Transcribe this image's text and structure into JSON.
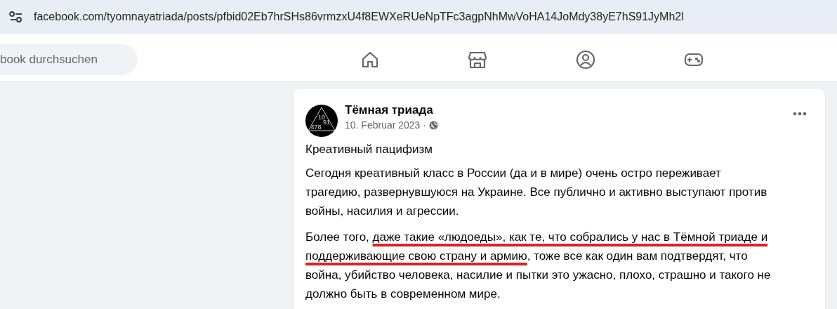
{
  "address_bar": {
    "url": "facebook.com/tyomnayatriada/posts/pfbid02Eb7hrSHs86vrmzxU4f8EWXeRUeNpTFc3agpNhMwVoHA14JoMdy38yE7hS91JyMh2l"
  },
  "search": {
    "placeholder": "book durchsuchen"
  },
  "nav": [
    {
      "kind": "home"
    },
    {
      "kind": "store"
    },
    {
      "kind": "groups"
    },
    {
      "kind": "gaming"
    }
  ],
  "post": {
    "author": "Тёмная триада",
    "avatar_marks": [
      "10",
      "91",
      "478"
    ],
    "date": "10. Februar 2023 ·",
    "title": "Креативный пацифизм",
    "paragraphs": [
      [
        {
          "text": "Сегодня креативный класс в России (да и в мире) очень остро переживает трагедию, развернувшуюся на Украине. Все публично и активно выступают против войны, насилия и агрессии.",
          "marked": false
        }
      ],
      [
        {
          "text": "Более того, ",
          "marked": false
        },
        {
          "text": "даже такие «людоеды», как те, что собрались у нас в Тёмной триаде и поддерживающие свою страну и армию",
          "marked": true
        },
        {
          "text": ", тоже все как один вам подтвердят, что война, убийство человека, насилие и пытки это ужасно, плохо, страшно и такого не должно быть в современном мире.",
          "marked": false
        }
      ]
    ]
  }
}
